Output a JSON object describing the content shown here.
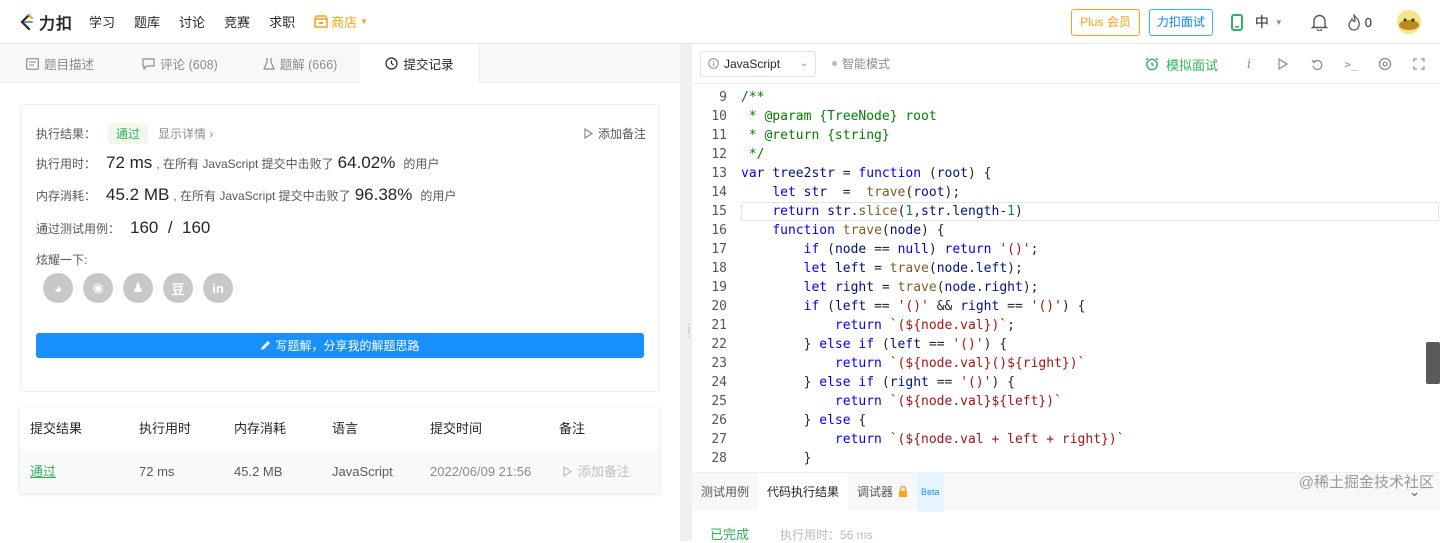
{
  "nav": {
    "logo_text": "力扣",
    "links": [
      "学习",
      "题库",
      "讨论",
      "竞赛",
      "求职"
    ],
    "store_label": "商店",
    "plus_label": "Plus 会员",
    "interview_label": "力扣面试",
    "lang_label": "中",
    "points": "0",
    "accent": "#ffa116"
  },
  "left": {
    "tabs": [
      {
        "label": "题目描述",
        "icon": "doc-icon"
      },
      {
        "label": "评论 (608)",
        "icon": "comment-icon"
      },
      {
        "label": "题解 (666)",
        "icon": "flask-icon"
      },
      {
        "label": "提交记录",
        "icon": "clock-icon"
      }
    ],
    "result": {
      "result_label": "执行结果：",
      "status": "通过",
      "details": "显示详情 ›",
      "add_note": "添加备注",
      "runtime_label": "执行用时：",
      "runtime_value": "72 ms",
      "runtime_text": ", 在所有 JavaScript 提交中击败了",
      "runtime_pct": "64.02%",
      "runtime_users": "的用户",
      "memory_label": "内存消耗：",
      "memory_value": "45.2 MB",
      "memory_text": ", 在所有 JavaScript 提交中击败了",
      "memory_pct": "96.38%",
      "memory_users": "的用户",
      "tests_label": "通过测试用例：",
      "tests_value": "160  /  160",
      "share_label": "炫耀一下:",
      "share_icons": [
        "wechat-icon",
        "weibo-icon",
        "qq-icon",
        "douban-icon",
        "linkedin-icon"
      ],
      "share_glyphs": [
        "◕",
        "◉",
        "♟",
        "豆",
        "in"
      ],
      "write_label": "写题解，分享我的解题思路"
    },
    "table": {
      "headers": [
        "提交结果",
        "执行用时",
        "内存消耗",
        "语言",
        "提交时间",
        "备注"
      ],
      "row": {
        "status": "通过",
        "runtime": "72 ms",
        "memory": "45.2 MB",
        "language": "JavaScript",
        "time": "2022/06/09 21:56",
        "note": "添加备注"
      }
    }
  },
  "editor": {
    "language": "JavaScript",
    "smart_mode": "智能模式",
    "mock_interview": "模拟面试",
    "lines": [
      {
        "n": "9",
        "html": "/**",
        "cls": "c"
      },
      {
        "n": "10",
        "text": " * @param {TreeNode} root"
      },
      {
        "n": "11",
        "text": " * @return {string}"
      },
      {
        "n": "12",
        "text": " */"
      },
      {
        "n": "13",
        "text": "var tree2str = function (root) {"
      },
      {
        "n": "14",
        "text": "    let str  =  trave(root);"
      },
      {
        "n": "15",
        "text": "    return str.slice(1,str.length-1)"
      },
      {
        "n": "16",
        "text": "    function trave(node) {"
      },
      {
        "n": "17",
        "text": "        if (node == null) return '()';"
      },
      {
        "n": "18",
        "text": "        let left = trave(node.left);"
      },
      {
        "n": "19",
        "text": "        let right = trave(node.right);"
      },
      {
        "n": "20",
        "text": "        if (left == '()' && right == '()') {"
      },
      {
        "n": "21",
        "text": "            return `(${node.val})`;"
      },
      {
        "n": "22",
        "text": "        } else if (left == '()') {"
      },
      {
        "n": "23",
        "text": "            return `(${node.val}()${right})`"
      },
      {
        "n": "24",
        "text": "        } else if (right == '()') {"
      },
      {
        "n": "25",
        "text": "            return `(${node.val}${left})`"
      },
      {
        "n": "26",
        "text": "        } else {"
      },
      {
        "n": "27",
        "text": "            return `(${node.val + left + right})`"
      },
      {
        "n": "28",
        "text": "        }"
      }
    ],
    "bottom_tabs": [
      "测试用例",
      "代码执行结果",
      "调试器"
    ],
    "beta": "Beta",
    "status": "已完成",
    "runtime_hint": "执行用时：56 ms"
  },
  "watermark": "@稀土掘金技术社区"
}
